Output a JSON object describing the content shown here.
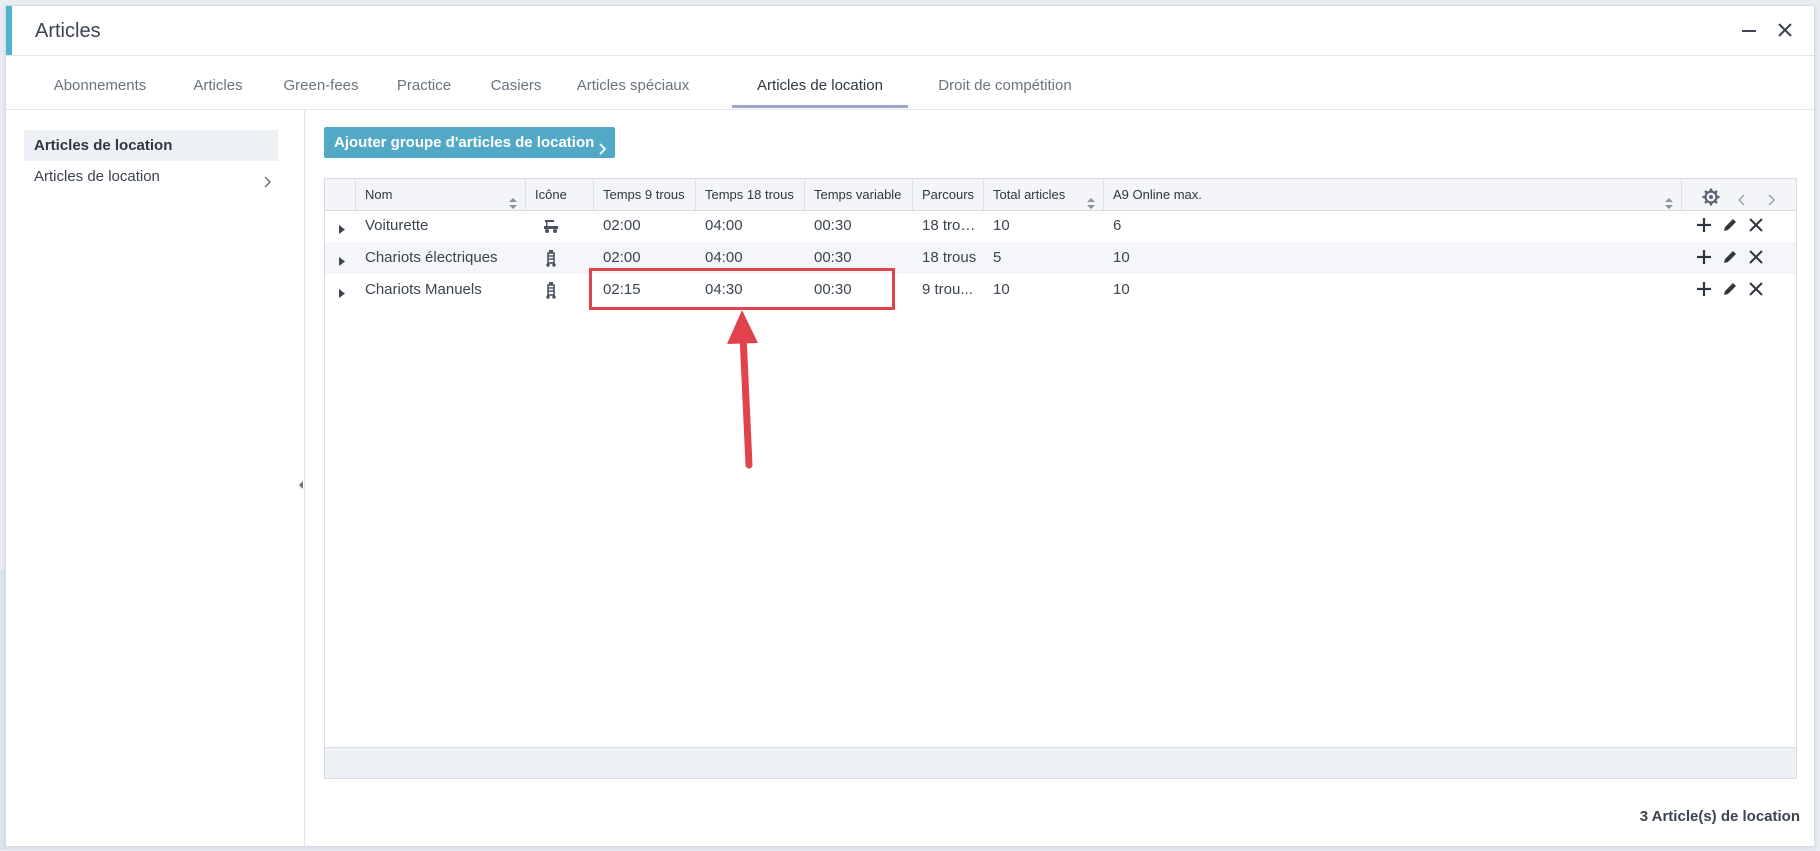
{
  "window": {
    "title": "Articles"
  },
  "tabs": [
    {
      "label": "Abonnements"
    },
    {
      "label": "Articles"
    },
    {
      "label": "Green-fees"
    },
    {
      "label": "Practice"
    },
    {
      "label": "Casiers"
    },
    {
      "label": "Articles spéciaux"
    },
    {
      "label": "Articles de location",
      "active": true
    },
    {
      "label": "Droit de compétition"
    }
  ],
  "sidebar": {
    "heading": "Articles de location",
    "items": [
      {
        "label": "Articles de location"
      }
    ]
  },
  "toolbar": {
    "add_group_label": "Ajouter groupe d'articles de location"
  },
  "table": {
    "columns": {
      "nom": "Nom",
      "icone": "Icône",
      "temps9": "Temps 9 trous",
      "temps18": "Temps 18 trous",
      "tempsvar": "Temps variable",
      "parcours": "Parcours",
      "total": "Total articles",
      "a9": "A9 Online max."
    },
    "rows": [
      {
        "nom": "Voiturette",
        "icon": "golf-cart-icon",
        "temps9": "02:00",
        "temps18": "04:00",
        "tempsvar": "00:30",
        "parcours": "18 trou...",
        "total": "10",
        "a9": "6"
      },
      {
        "nom": "Chariots électriques",
        "icon": "golf-trolley-icon",
        "temps9": "02:00",
        "temps18": "04:00",
        "tempsvar": "00:30",
        "parcours": "18 trous",
        "total": "5",
        "a9": "10"
      },
      {
        "nom": "Chariots Manuels",
        "icon": "golf-trolley-icon",
        "temps9": "02:15",
        "temps18": "04:30",
        "tempsvar": "00:30",
        "parcours": "9 trou...",
        "total": "10",
        "a9": "10"
      }
    ]
  },
  "status": {
    "count_text": "3 Article(s) de location"
  },
  "colors": {
    "accent": "#53b3cd",
    "button": "#52a9c6",
    "highlight": "#e0434b"
  }
}
